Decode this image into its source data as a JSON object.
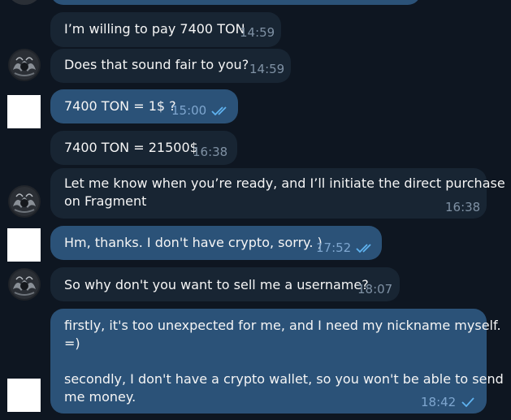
{
  "messages": [
    {
      "text": "I’m willing to pay 7400 TON",
      "time": "14:59"
    },
    {
      "text": "Does that sound fair to you?",
      "time": "14:59"
    },
    {
      "text": "7400 TON = 1$ ?",
      "time": "15:00"
    },
    {
      "text": "7400 TON = 21500$",
      "time": "16:38"
    },
    {
      "text_line1": "Let me know when you’re ready, and I’ll initiate the direct purchase",
      "text_line2": "on Fragment",
      "time": "16:38"
    },
    {
      "text": "Hm, thanks. I don't have crypto, sorry. )",
      "time": "17:52"
    },
    {
      "text": "So why don't you want to sell me a username?",
      "time": "18:07"
    },
    {
      "text_line1": "firstly, it's too unexpected for me, and I need my nickname myself.",
      "text_line2": "=)",
      "text_line3": "secondly, I don't have a crypto wallet, so you won't be able to send",
      "text_line4": "me money.",
      "time": "18:42"
    }
  ],
  "icons": {
    "read_receipt": "double-check-icon",
    "sent_receipt": "single-check-icon",
    "contact_avatar": "contact-avatar-icon",
    "own_avatar": "own-avatar-icon"
  },
  "colors": {
    "background": "#0e1621",
    "incoming_bubble": "#182533",
    "outgoing_bubble": "#2b5278",
    "text": "#f5f5f5",
    "time_incoming": "#7f91a4",
    "time_outgoing": "#7ea6cf",
    "check": "#5fb3f0"
  }
}
